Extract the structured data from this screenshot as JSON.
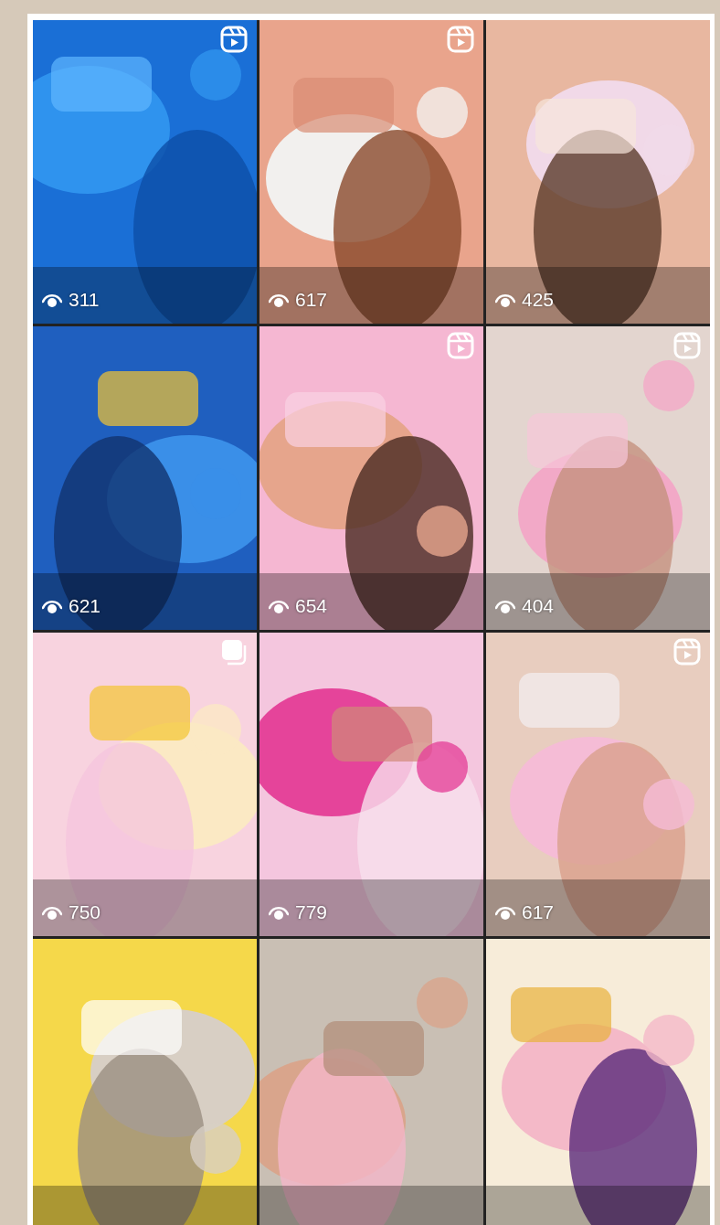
{
  "posts": [
    {
      "kind": "picture",
      "reel": true,
      "multiple": false,
      "views": "311"
    },
    {
      "kind": "picture",
      "reel": true,
      "multiple": false,
      "views": "617"
    },
    {
      "kind": "picture",
      "reel": false,
      "multiple": false,
      "views": "425"
    },
    {
      "kind": "picture",
      "reel": false,
      "multiple": false,
      "views": "621"
    },
    {
      "kind": "picture",
      "reel": true,
      "multiple": false,
      "views": "654"
    },
    {
      "kind": "picture",
      "reel": true,
      "multiple": false,
      "views": "404"
    },
    {
      "kind": "picture",
      "reel": false,
      "multiple": true,
      "views": "750"
    },
    {
      "kind": "picture",
      "reel": false,
      "multiple": false,
      "views": "779"
    },
    {
      "kind": "picture",
      "reel": true,
      "multiple": false,
      "views": "617"
    },
    {
      "kind": "picture",
      "reel": false,
      "multiple": false
    },
    {
      "kind": "picture",
      "reel": false,
      "multiple": false
    },
    {
      "kind": "picture",
      "reel": false,
      "multiple": false
    }
  ]
}
